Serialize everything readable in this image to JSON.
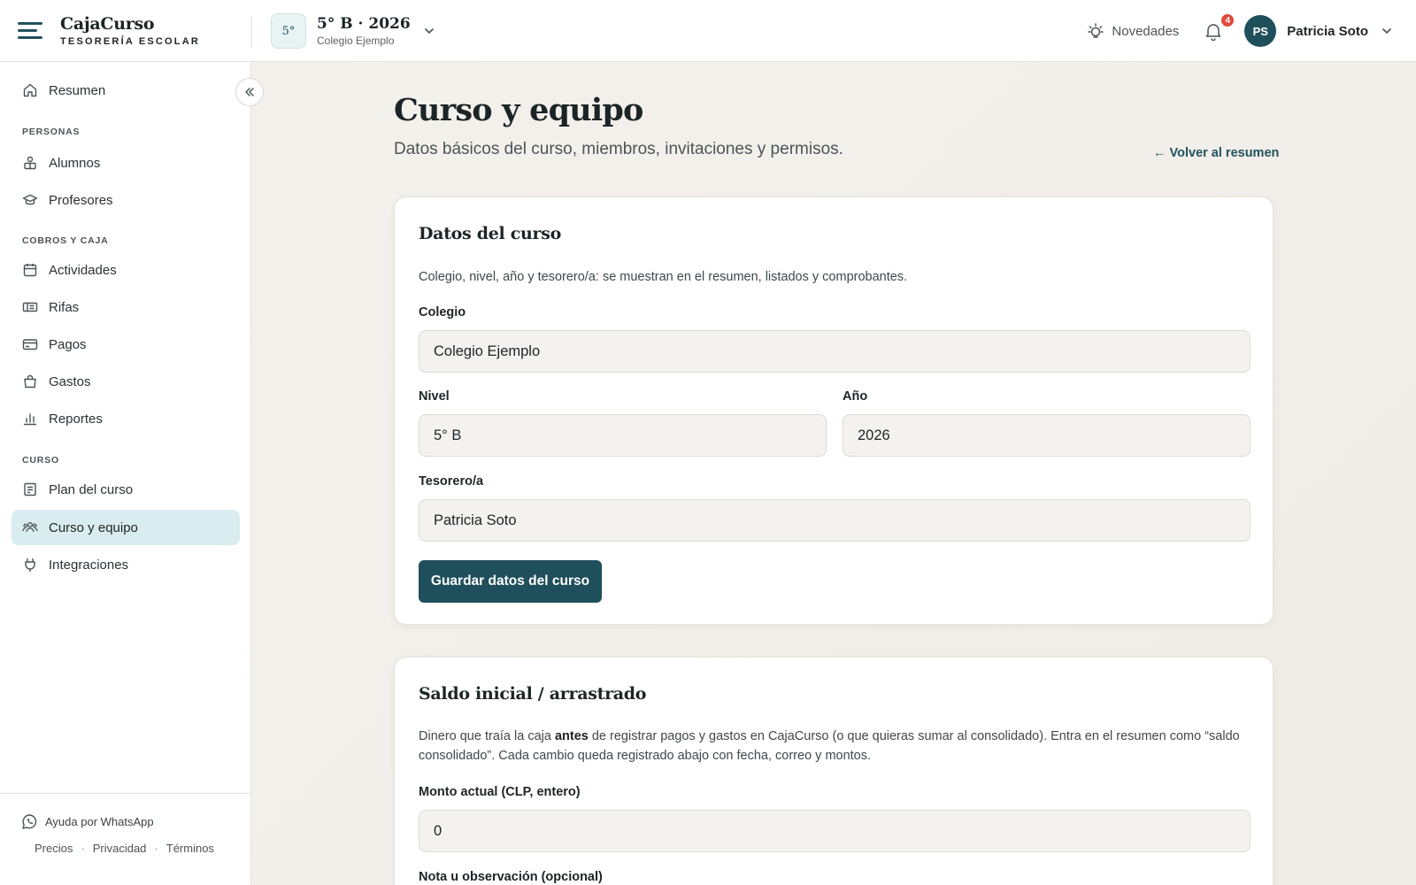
{
  "brand": {
    "name": "CajaCurso",
    "tagline": "TESORERÍA ESCOLAR"
  },
  "course_switcher": {
    "badge": "5°",
    "title": "5° B · 2026",
    "school": "Colegio Ejemplo"
  },
  "header": {
    "news_label": "Novedades",
    "notifications_count": "4",
    "user_initials": "PS",
    "user_name": "Patricia Soto"
  },
  "sidebar": {
    "summary": "Resumen",
    "sections": {
      "people": "PERSONAS",
      "billing": "COBROS Y CAJA",
      "course": "CURSO"
    },
    "items": {
      "students": "Alumnos",
      "teachers": "Profesores",
      "activities": "Actividades",
      "raffles": "Rifas",
      "payments": "Pagos",
      "expenses": "Gastos",
      "reports": "Reportes",
      "course_plan": "Plan del curso",
      "course_team": "Curso y equipo",
      "integrations": "Integraciones"
    },
    "active_item": "Curso y equipo",
    "whatsapp_help": "Ayuda por WhatsApp",
    "footer_links": [
      "Precios",
      "Privacidad",
      "Términos"
    ]
  },
  "page": {
    "title": "Curso y equipo",
    "subtitle": "Datos básicos del curso, miembros, invitaciones y permisos.",
    "back_link": "← Volver al resumen"
  },
  "course_card": {
    "title": "Datos del curso",
    "description": "Colegio, nivel, año y tesorero/a: se muestran en el resumen, listados y comprobantes.",
    "school_label": "Colegio",
    "school_value": "Colegio Ejemplo",
    "level_label": "Nivel",
    "level_value": "5° B",
    "year_label": "Año",
    "year_value": "2026",
    "treasurer_label": "Tesorero/a",
    "treasurer_value": "Patricia Soto",
    "save_button": "Guardar datos del curso"
  },
  "balance_card": {
    "title": "Saldo inicial / arrastrado",
    "desc_before": "Dinero que traía la caja ",
    "desc_bold": "antes",
    "desc_line1_after": " de registrar pagos y gastos en CajaCurso (o que quieras sumar al consolidado). Entra en el resumen como “saldo",
    "desc_line2": "consolidado”. Cada cambio queda registrado abajo con fecha, correo y montos.",
    "amount_label": "Monto actual (CLP, entero)",
    "amount_value": "0",
    "note_label": "Nota u observación (opcional)"
  },
  "colors": {
    "primary": "#1f4f5b",
    "active_nav": "#d9ecef",
    "badge": "#e04a3c"
  }
}
